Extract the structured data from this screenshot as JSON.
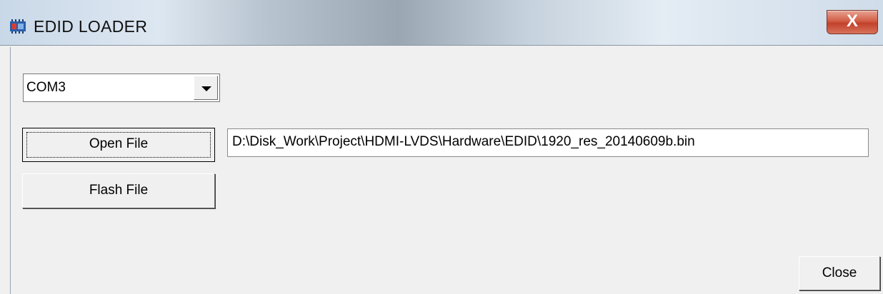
{
  "window": {
    "title": "EDID LOADER",
    "close_glyph": "X",
    "icon": "app-chip-icon"
  },
  "port": {
    "selected": "COM3"
  },
  "buttons": {
    "open_file": "Open File",
    "flash_file": "Flash File",
    "close": "Close"
  },
  "file": {
    "path": "D:\\Disk_Work\\Project\\HDMI-LVDS\\Hardware\\EDID\\1920_res_20140609b.bin"
  }
}
